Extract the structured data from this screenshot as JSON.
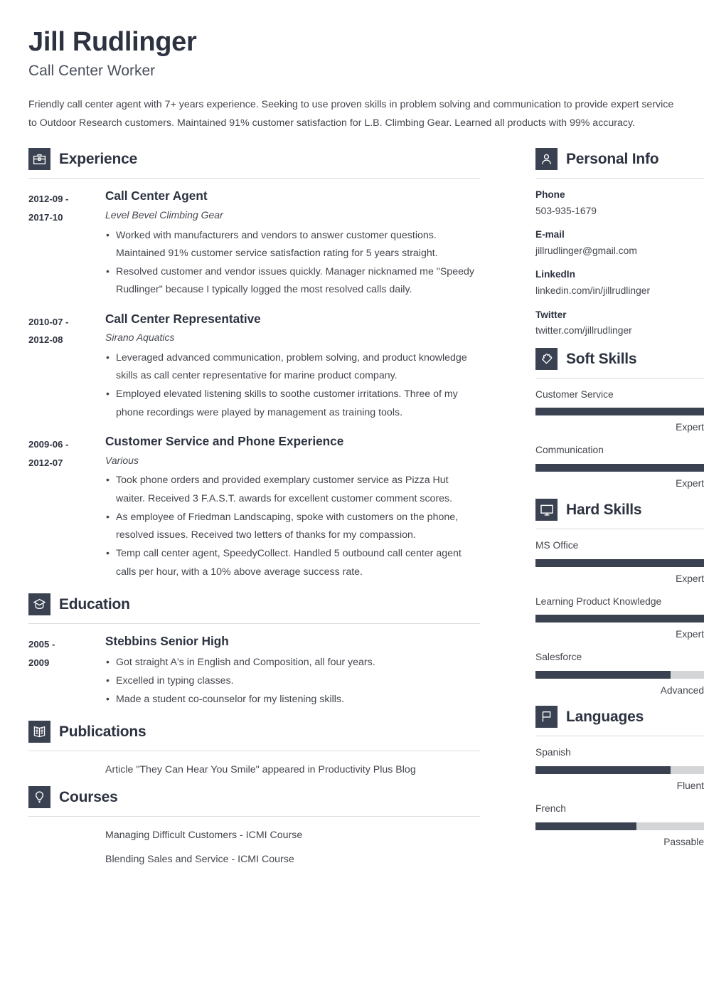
{
  "colors": {
    "accent_dark": "#3a4150",
    "heading": "#2c3240",
    "body_text": "#43464d",
    "bar_track": "#d4d5d7",
    "rule": "#dcdcdc"
  },
  "header": {
    "name": "Jill Rudlinger",
    "job_title": "Call Center Worker",
    "summary": "Friendly call center agent with 7+ years experience. Seeking to use proven skills in problem solving and communication to provide expert service to Outdoor Research customers. Maintained 91% customer satisfaction for L.B. Climbing Gear. Learned all products with 99% accuracy."
  },
  "main": {
    "experience": {
      "title": "Experience",
      "icon": "briefcase-icon",
      "entries": [
        {
          "dates": "2012-09 - 2017-10",
          "date_start": "2012-09 -",
          "date_end": "2017-10",
          "title": "Call Center Agent",
          "org": "Level Bevel Climbing Gear",
          "bullets": [
            "Worked with manufacturers and vendors to answer customer questions. Maintained 91% customer service satisfaction rating for 5 years straight.",
            "Resolved customer and vendor issues quickly. Manager nicknamed me \"Speedy Rudlinger\" because I typically logged the most resolved calls daily."
          ]
        },
        {
          "dates": "2010-07 - 2012-08",
          "date_start": "2010-07 -",
          "date_end": "2012-08",
          "title": "Call Center Representative",
          "org": "Sirano Aquatics",
          "bullets": [
            "Leveraged advanced communication, problem solving, and product knowledge skills as call center representative for marine product company.",
            "Employed elevated listening skills to soothe customer irritations. Three of my phone recordings were played by management as training tools."
          ]
        },
        {
          "dates": "2009-06 - 2012-07",
          "date_start": "2009-06 -",
          "date_end": "2012-07",
          "title": "Customer Service and Phone Experience",
          "org": "Various",
          "bullets": [
            "Took phone orders and provided exemplary customer service as Pizza Hut waiter. Received 3 F.A.S.T. awards for excellent customer comment scores.",
            "As employee of Friedman Landscaping, spoke with customers on the phone, resolved issues. Received two letters of thanks for my compassion.",
            "Temp call center agent, SpeedyCollect. Handled 5 outbound call center agent calls per hour, with a 10% above average success rate."
          ]
        }
      ]
    },
    "education": {
      "title": "Education",
      "icon": "graduation-cap-icon",
      "entries": [
        {
          "date_start": "2005 -",
          "date_end": "2009",
          "title": "Stebbins Senior High",
          "org": "",
          "bullets": [
            "Got straight A's in English and Composition, all four years.",
            "Excelled in typing classes.",
            "Made a student co-counselor for my listening skills."
          ]
        }
      ]
    },
    "publications": {
      "title": "Publications",
      "icon": "open-book-icon",
      "entries": [
        {
          "date_start": "",
          "date_end": "",
          "text": "Article \"They Can Hear You Smile\" appeared in Productivity Plus Blog"
        }
      ]
    },
    "courses": {
      "title": "Courses",
      "icon": "lightbulb-icon",
      "entries": [
        {
          "date_start": "",
          "date_end": "",
          "text": "Managing Difficult Customers - ICMI Course"
        },
        {
          "date_start": "",
          "date_end": "",
          "text": "Blending Sales and Service - ICMI Course"
        }
      ]
    }
  },
  "sidebar": {
    "personal_info": {
      "title": "Personal Info",
      "icon": "person-icon",
      "items": [
        {
          "label": "Phone",
          "value": "503-935-1679"
        },
        {
          "label": "E-mail",
          "value": "jillrudlinger@gmail.com"
        },
        {
          "label": "LinkedIn",
          "value": "linkedin.com/in/jillrudlinger"
        },
        {
          "label": "Twitter",
          "value": "twitter.com/jillrudlinger"
        }
      ]
    },
    "soft_skills": {
      "title": "Soft Skills",
      "icon": "puzzle-heart-icon",
      "items": [
        {
          "name": "Customer Service",
          "level": "Expert",
          "percent": 100
        },
        {
          "name": "Communication",
          "level": "Expert",
          "percent": 100
        }
      ]
    },
    "hard_skills": {
      "title": "Hard Skills",
      "icon": "monitor-icon",
      "items": [
        {
          "name": "MS Office",
          "level": "Expert",
          "percent": 100
        },
        {
          "name": "Learning Product Knowledge",
          "level": "Expert",
          "percent": 100
        },
        {
          "name": "Salesforce",
          "level": "Advanced",
          "percent": 80
        }
      ]
    },
    "languages": {
      "title": "Languages",
      "icon": "flag-icon",
      "items": [
        {
          "name": "Spanish",
          "level": "Fluent",
          "percent": 80
        },
        {
          "name": "French",
          "level": "Passable",
          "percent": 60
        }
      ]
    }
  }
}
